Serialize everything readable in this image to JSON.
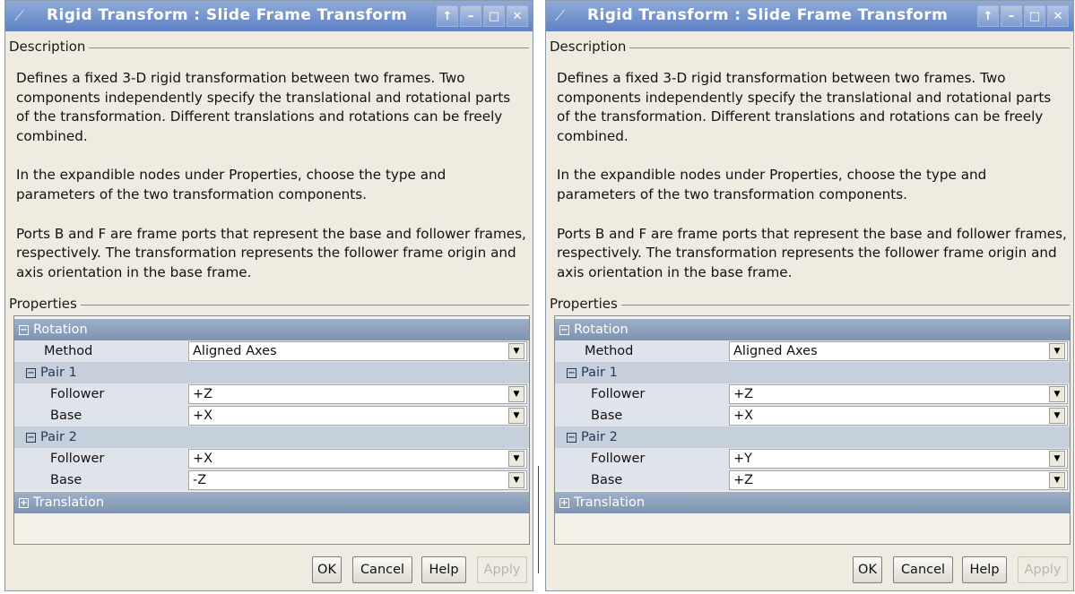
{
  "dialogs": [
    {
      "title": "Rigid Transform : Slide Frame Transform",
      "window_buttons": [
        "↑",
        "–",
        "□",
        "✕"
      ],
      "description_label": "Description",
      "description": [
        "Defines a fixed 3-D rigid transformation between two frames. Two components independently specify the translational and rotational parts of the transformation. Different translations and rotations can be freely combined.",
        "In the expandible nodes under Properties, choose the type and parameters of the two transformation components.",
        "Ports B and F are frame ports that represent the base and follower frames, respectively. The transformation represents the follower frame origin and axis orientation in the base frame."
      ],
      "properties_label": "Properties",
      "rotation_header": "Rotation",
      "method_label": "Method",
      "method_value": "Aligned Axes",
      "pair1_header": "Pair 1",
      "pair1_follower_label": "Follower",
      "pair1_follower_value": "+Z",
      "pair1_base_label": "Base",
      "pair1_base_value": "+X",
      "pair2_header": "Pair 2",
      "pair2_follower_label": "Follower",
      "pair2_follower_value": "+X",
      "pair2_base_label": "Base",
      "pair2_base_value": "-Z",
      "translation_header": "Translation",
      "buttons": {
        "ok": "OK",
        "cancel": "Cancel",
        "help": "Help",
        "apply": "Apply"
      }
    },
    {
      "title": "Rigid Transform : Slide Frame Transform",
      "window_buttons": [
        "↑",
        "–",
        "□",
        "✕"
      ],
      "description_label": "Description",
      "description": [
        "Defines a fixed 3-D rigid transformation between two frames. Two components independently specify the translational and rotational parts of the transformation. Different translations and rotations can be freely combined.",
        "In the expandible nodes under Properties, choose the type and parameters of the two transformation components.",
        "Ports B and F are frame ports that represent the base and follower frames, respectively. The transformation represents the follower frame origin and axis orientation in the base frame."
      ],
      "properties_label": "Properties",
      "rotation_header": "Rotation",
      "method_label": "Method",
      "method_value": "Aligned Axes",
      "pair1_header": "Pair 1",
      "pair1_follower_label": "Follower",
      "pair1_follower_value": "+Z",
      "pair1_base_label": "Base",
      "pair1_base_value": "+X",
      "pair2_header": "Pair 2",
      "pair2_follower_label": "Follower",
      "pair2_follower_value": "+Y",
      "pair2_base_label": "Base",
      "pair2_base_value": "+Z",
      "translation_header": "Translation",
      "buttons": {
        "ok": "OK",
        "cancel": "Cancel",
        "help": "Help",
        "apply": "Apply"
      }
    }
  ],
  "icons": {
    "expanded": "⊟",
    "collapsed": "⊞",
    "dropdown": "▼",
    "app": "⟋"
  }
}
